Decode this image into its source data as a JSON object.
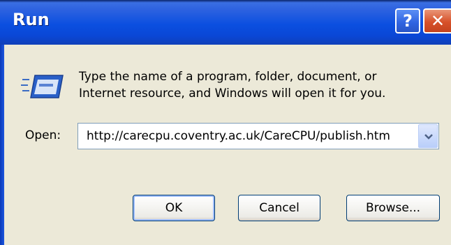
{
  "window": {
    "title": "Run",
    "help_glyph": "?",
    "close_glyph": "✕"
  },
  "content": {
    "icon": "run-icon",
    "description_line1": "Type the name of a program, folder, document, or",
    "description_line2": "Internet resource, and Windows will open it for you.",
    "open_label": "Open:",
    "open_value": "http://carecpu.coventry.ac.uk/CareCPU/publish.htm"
  },
  "buttons": {
    "ok": "OK",
    "cancel": "Cancel",
    "browse": "Browse..."
  },
  "colors": {
    "titlebar": "#0b4fe0",
    "dialog_bg": "#ece9d8",
    "close_btn": "#d7512a"
  }
}
